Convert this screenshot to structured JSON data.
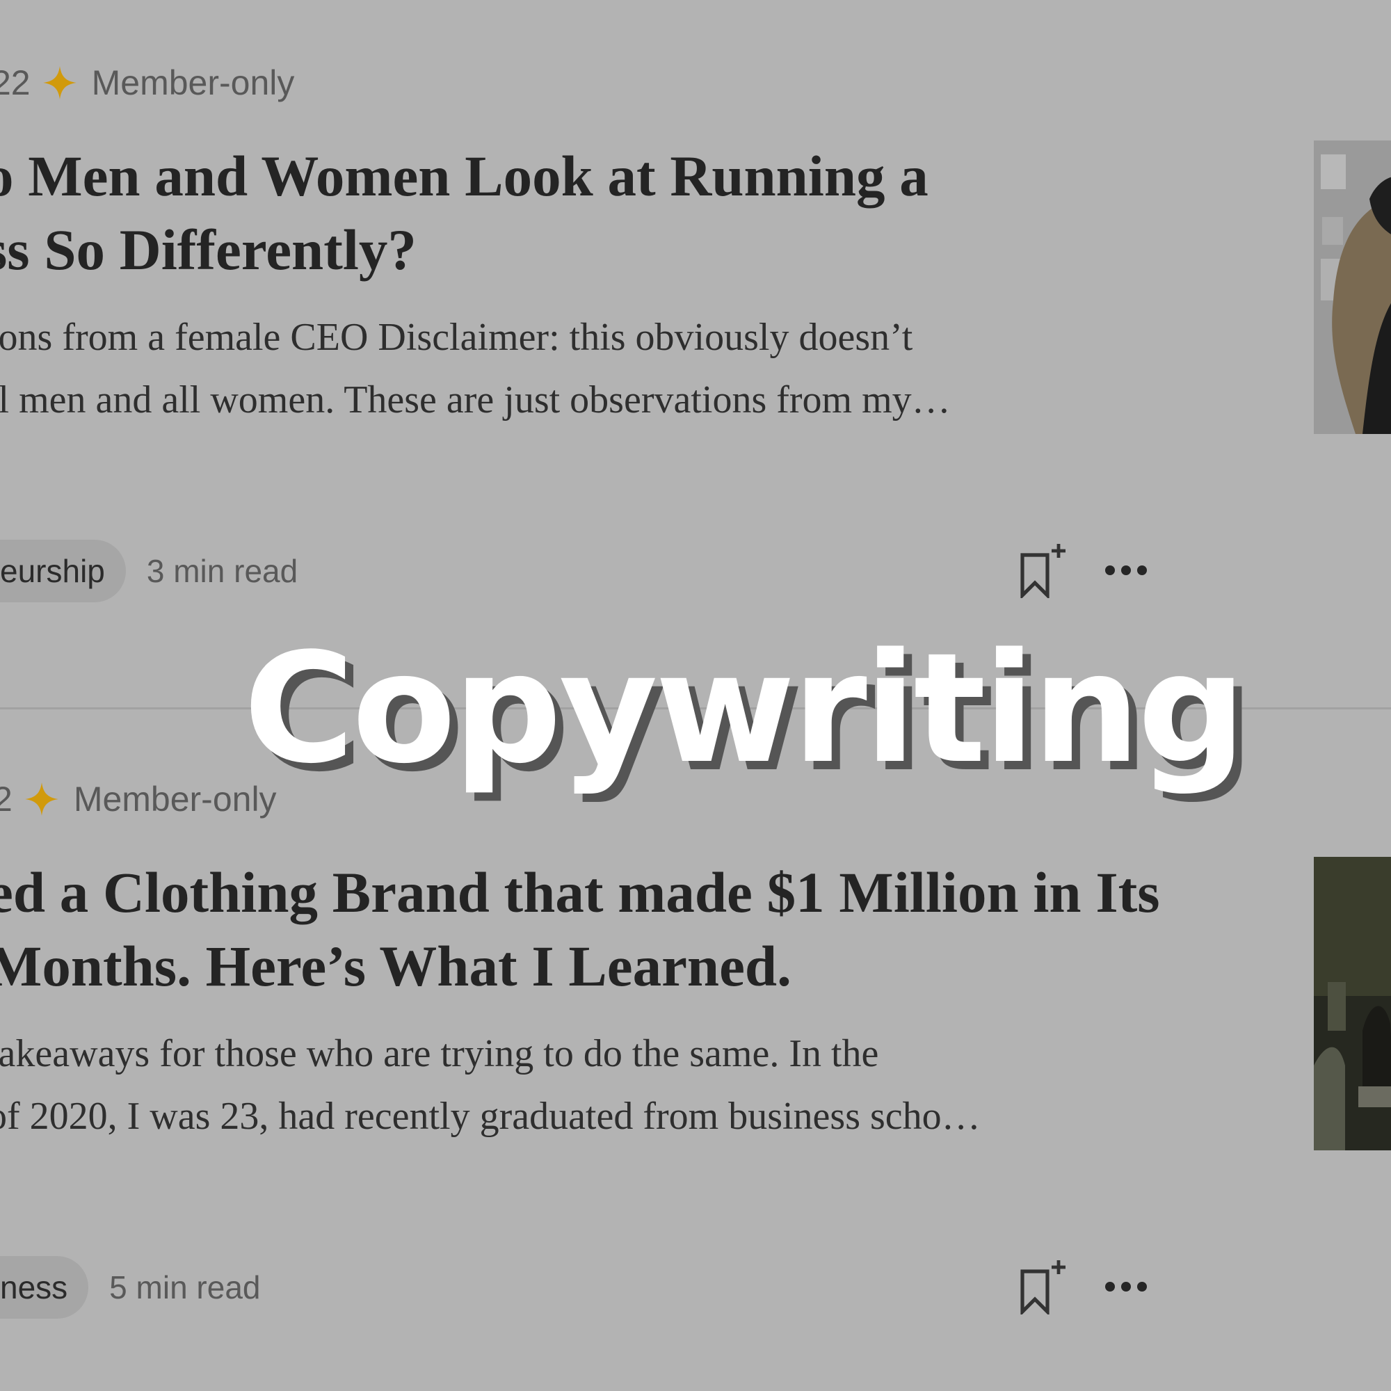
{
  "articles": [
    {
      "date_fragment": "22",
      "membership": "Member-only",
      "title_lines": [
        "o Men and Women Look at Running a",
        "ss So Differently?"
      ],
      "excerpt_lines": [
        "ions from a female CEO Disclaimer: this obviously doesn’t",
        "ll men and all women. These are just observations from my…"
      ],
      "tag": "eurship",
      "read_time": "3 min read"
    },
    {
      "date_fragment": "2",
      "membership": "Member-only",
      "title_lines": [
        "ed a Clothing Brand that made $1 Million in Its",
        " Months. Here’s What I Learned."
      ],
      "excerpt_lines": [
        " takeaways for those who are trying to do the same. In the",
        "of 2020, I was 23, had recently graduated from business scho…"
      ],
      "tag": "ness",
      "read_time": "5 min read"
    }
  ],
  "overlay": {
    "text": "Copywriting"
  },
  "icons": {
    "membership": "star-icon",
    "save": "bookmark-add-icon",
    "more": "more-options-icon"
  },
  "colors": {
    "background": "#b3b3b3",
    "member_star": "#d19a0c",
    "overlay_text": "#ffffff",
    "overlay_shadow": "#555555"
  }
}
